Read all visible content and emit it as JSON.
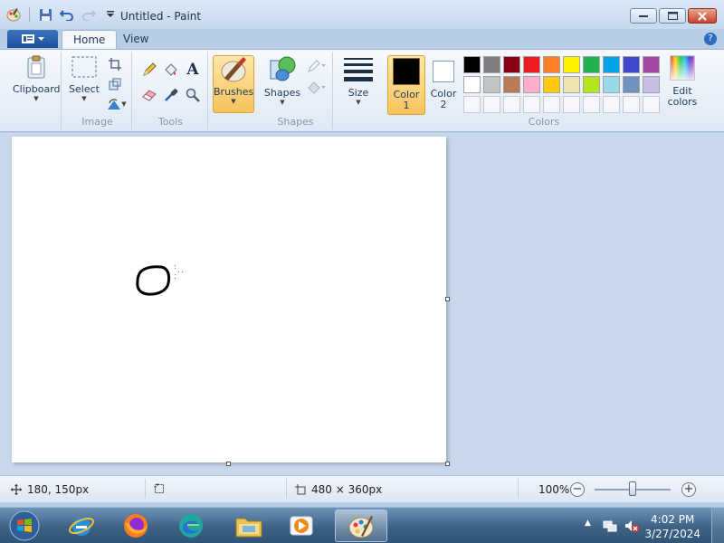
{
  "window": {
    "title": "Untitled - Paint"
  },
  "ribbon_tabs": [
    {
      "label": "Home",
      "active": true
    },
    {
      "label": "View",
      "active": false
    }
  ],
  "groups": {
    "image": "Image",
    "tools": "Tools",
    "shapes": "Shapes",
    "colors": "Colors"
  },
  "buttons": {
    "clipboard": "Clipboard",
    "select": "Select",
    "brushes": "Brushes",
    "shapes": "Shapes",
    "size": "Size",
    "color1_line1": "Color",
    "color1_line2": "1",
    "color2_line1": "Color",
    "color2_line2": "2",
    "edit_colors_line1": "Edit",
    "edit_colors_line2": "colors",
    "text_tool": "A"
  },
  "palette": {
    "row1": [
      "#000000",
      "#7f7f7f",
      "#880015",
      "#ed1c24",
      "#ff7f27",
      "#fff200",
      "#22b14c",
      "#00a2e8",
      "#3f48cc",
      "#a349a4"
    ],
    "row2": [
      "#ffffff",
      "#c3c3c3",
      "#b97a57",
      "#ffaec9",
      "#ffc90e",
      "#efe4b0",
      "#b5e61d",
      "#99d9ea",
      "#7092be",
      "#c8bfe7"
    ],
    "row3_empty_count": 10,
    "color1": "#000000",
    "color2": "#ffffff"
  },
  "status": {
    "cursor_pos": "180, 150px",
    "canvas_size": "480 × 360px",
    "zoom": "100%",
    "zoom_level_fraction": 0.5
  },
  "taskbar": {
    "time": "4:02 PM",
    "date": "3/27/2024",
    "apps": [
      "start-orb",
      "internet-explorer",
      "firefox",
      "edge",
      "file-explorer",
      "media-player",
      "paint"
    ]
  }
}
